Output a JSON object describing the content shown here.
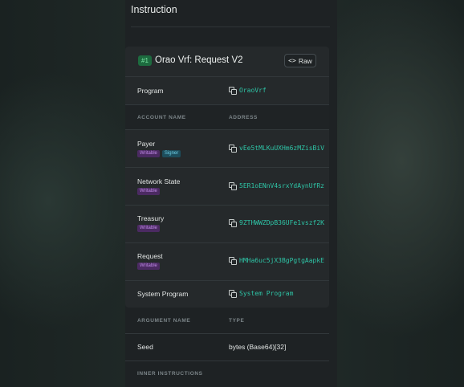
{
  "section_title": "Instruction",
  "instruction": {
    "index_badge": "#1",
    "title": "Orao Vrf: Request V2",
    "raw_button": {
      "icon": "code-icon",
      "label": "Raw"
    },
    "program": {
      "label": "Program",
      "value": "OraoVrf"
    },
    "accounts_header": {
      "name": "ACCOUNT NAME",
      "address": "ADDRESS"
    },
    "accounts": [
      {
        "name": "Payer",
        "tags": [
          "Writable",
          "Signer"
        ],
        "address": "vEe5tMLKuUXHm6zMZisBiV"
      },
      {
        "name": "Network State",
        "tags": [
          "Writable"
        ],
        "address": "5ER1oENnV4srxYdAynUfRz"
      },
      {
        "name": "Treasury",
        "tags": [
          "Writable"
        ],
        "address": "9ZTHWWZDpB36UFe1vszf2K"
      },
      {
        "name": "Request",
        "tags": [
          "Writable"
        ],
        "address": "HMHa6uc5jX3BgPgtgAapkE"
      },
      {
        "name": "System Program",
        "tags": [],
        "address": "System Program"
      }
    ],
    "arguments_header": {
      "name": "ARGUMENT NAME",
      "type": "TYPE"
    },
    "arguments": [
      {
        "name": "Seed",
        "type": "bytes (Base64)[32]"
      }
    ],
    "inner_instructions_header": "INNER INSTRUCTIONS"
  },
  "colors": {
    "panel_bg": "#1e2224",
    "card_bg": "#25292b",
    "address_green": "#2ec4a6",
    "writable_tag": "#4b2a62",
    "signer_tag": "#1d4d5c",
    "index_badge": "#1d6b3f"
  }
}
